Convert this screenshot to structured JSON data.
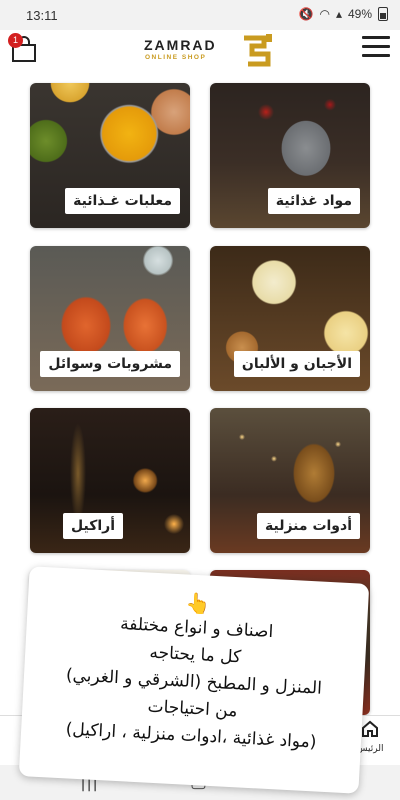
{
  "status_bar": {
    "time": "13:11",
    "battery": "49%"
  },
  "header": {
    "brand_name": "ZAMRAD",
    "brand_tagline": "ONLINE SHOP",
    "cart_count": "1"
  },
  "categories": [
    {
      "label": "مواد غذائية"
    },
    {
      "label": "معلبات غـذائية"
    },
    {
      "label": "الأجبان و الألبان"
    },
    {
      "label": "مشروبات وسوائل"
    },
    {
      "label": "أدوات منزلية"
    },
    {
      "label": "أراكيل"
    }
  ],
  "bottom_nav": {
    "home_label": "الرئيس"
  },
  "note": {
    "emoji": "👆",
    "lines": [
      "اصناف و انواع مختلفة",
      "كل ما يحتاجه",
      "المنزل و المطبخ  (الشرقي و الغربي)",
      "من احتياجات",
      "(مواد غذائية ،ادوات منزلية ، اراكيل)"
    ]
  },
  "colors": {
    "accent": "#c99b20",
    "badge": "#d32020"
  }
}
